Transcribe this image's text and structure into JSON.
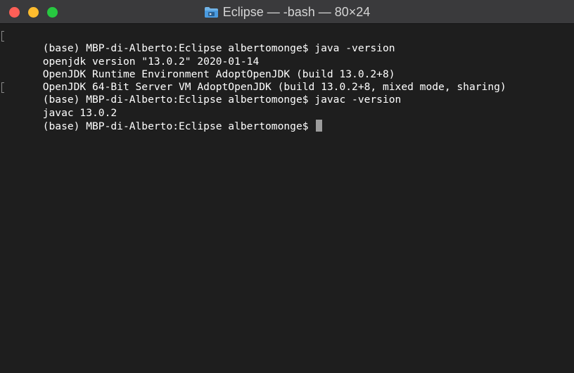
{
  "window": {
    "title": "Eclipse — -bash — 80×24",
    "icon": "folder-icon"
  },
  "terminal": {
    "lines": [
      "(base) MBP-di-Alberto:Eclipse albertomonge$ java -version",
      "openjdk version \"13.0.2\" 2020-01-14",
      "OpenJDK Runtime Environment AdoptOpenJDK (build 13.0.2+8)",
      "OpenJDK 64-Bit Server VM AdoptOpenJDK (build 13.0.2+8, mixed mode, sharing)",
      "(base) MBP-di-Alberto:Eclipse albertomonge$ javac -version",
      "javac 13.0.2",
      "(base) MBP-di-Alberto:Eclipse albertomonge$ "
    ]
  },
  "colors": {
    "background": "#1e1e1e",
    "text": "#ffffff",
    "close": "#fe5f57",
    "minimize": "#febc2e",
    "maximize": "#27c840"
  }
}
